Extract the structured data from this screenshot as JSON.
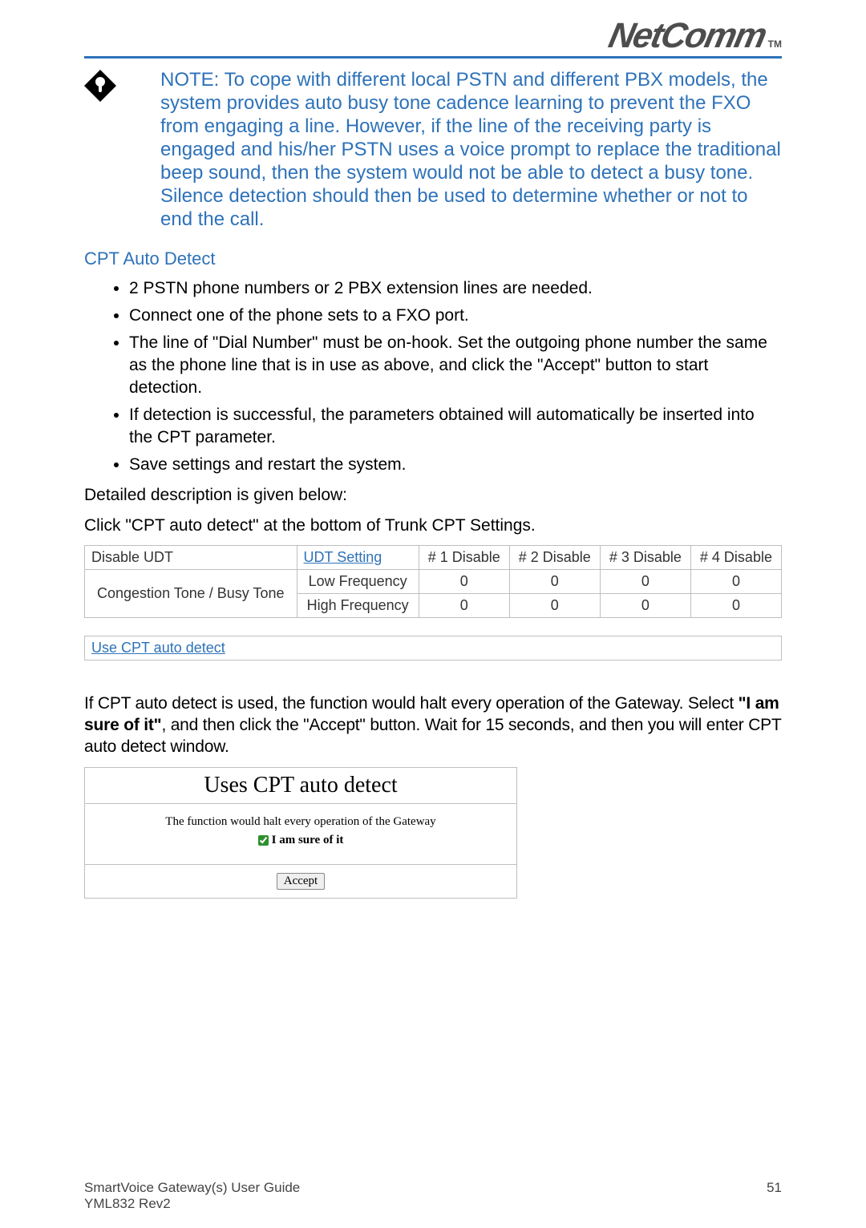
{
  "brand": {
    "name": "NetComm",
    "tm": "TM"
  },
  "note": "NOTE: To cope with different local PSTN and different PBX models, the system provides auto busy tone cadence learning to prevent the FXO from engaging a line. However, if the line of the receiving party is engaged and his/her PSTN uses a voice prompt to replace the traditional beep sound, then the system would not be able to detect a busy tone. Silence detection should then be used to determine whether or not to end the call.",
  "section_title": "CPT Auto Detect",
  "bullets": [
    "2 PSTN phone numbers or 2 PBX extension lines are needed.",
    "Connect one of the phone sets to a FXO port.",
    "The line of \"Dial Number\" must be on-hook. Set the outgoing phone number the same as the phone line that is in use as above, and click the \"Accept\" button to start detection.",
    "If detection is successful, the parameters obtained will automatically be inserted into the CPT parameter.",
    "Save settings and restart the system."
  ],
  "desc1": "Detailed description is given below:",
  "desc2": "Click \"CPT auto detect\" at the bottom of Trunk CPT Settings.",
  "udt": {
    "disable_label": "Disable UDT",
    "setting_link": "UDT Setting",
    "cols": [
      "# 1 Disable",
      "# 2 Disable",
      "# 3 Disable",
      "# 4 Disable"
    ],
    "row_label": "Congestion Tone / Busy Tone",
    "sub": [
      "Low Frequency",
      "High Frequency"
    ],
    "values": [
      [
        "0",
        "0",
        "0",
        "0"
      ],
      [
        "0",
        "0",
        "0",
        "0"
      ]
    ]
  },
  "use_link": "Use CPT auto detect",
  "para2_a": "If CPT auto detect is used, the function would halt every operation of the Gateway. Select ",
  "para2_b": "\"I am sure of it\"",
  "para2_c": ", and then click the \"Accept\" button.  Wait for 15 seconds, and then you will enter CPT auto detect window.",
  "dialog": {
    "title": "Uses CPT auto detect",
    "warn": "The function would halt every operation of the Gateway",
    "sure": "I am sure of it",
    "accept": "Accept"
  },
  "footer": {
    "title": "SmartVoice Gateway(s) User Guide",
    "rev": "YML832 Rev2",
    "page": "51"
  }
}
